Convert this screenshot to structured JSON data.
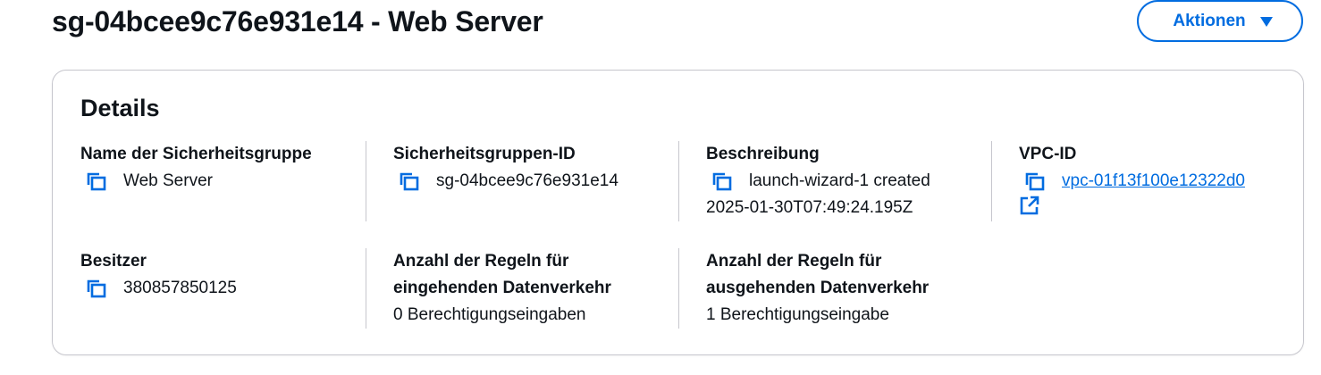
{
  "header": {
    "title": "sg-04bcee9c76e931e14 - Web Server",
    "actions_label": "Aktionen",
    "actions_icon": "caret-down-icon"
  },
  "details": {
    "heading": "Details",
    "fields": {
      "security_group_name": {
        "label": "Name der Sicherheitsgruppe",
        "value": "Web Server"
      },
      "security_group_id": {
        "label": "Sicherheitsgruppen-ID",
        "value": "sg-04bcee9c76e931e14"
      },
      "description": {
        "label": "Beschreibung",
        "value_line1": "launch-wizard-1 created",
        "value_line2": "2025-01-30T07:49:24.195Z"
      },
      "vpc_id": {
        "label": "VPC-ID",
        "value": "vpc-01f13f100e12322d0",
        "external_icon": "external-link-icon"
      },
      "owner": {
        "label": "Besitzer",
        "value": "380857850125"
      },
      "inbound_rules": {
        "label_line1": "Anzahl der Regeln für",
        "label_line2": "eingehenden Datenverkehr",
        "value": "0 Berechtigungseingaben"
      },
      "outbound_rules": {
        "label_line1": "Anzahl der Regeln für",
        "label_line2": "ausgehenden Datenverkehr",
        "value": "1 Berechtigungseingabe"
      }
    }
  },
  "colors": {
    "accent": "#006ce0",
    "text": "#0f141a",
    "border": "#c6c6cd"
  }
}
